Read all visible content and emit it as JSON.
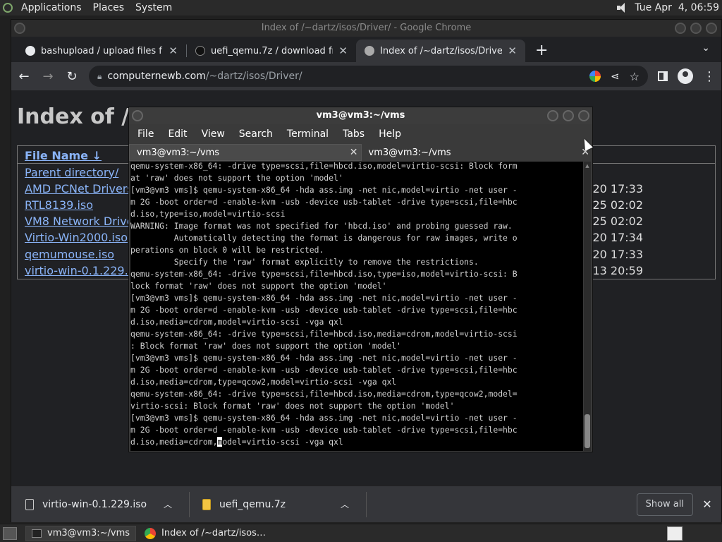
{
  "top_panel": {
    "menus": [
      "Applications",
      "Places",
      "System"
    ],
    "clock": "Tue Apr  4, 06:59"
  },
  "chrome": {
    "window_title": "Index of /~dartz/isos/Driver/ - Google Chrome",
    "tabs": [
      {
        "title": "bashupload / upload files from",
        "active": false
      },
      {
        "title": "uefi_qemu.7z / download from",
        "active": false
      },
      {
        "title": "Index of /~dartz/isos/Driver/",
        "active": true
      }
    ],
    "url_host": "computernewb.com",
    "url_path": "/~dartz/isos/Driver/"
  },
  "page": {
    "heading": "Index of /~",
    "column_header": "File Name  ↓",
    "files": [
      {
        "name": "Parent directory/",
        "date": ""
      },
      {
        "name": "AMD PCNet Drivers.",
        "date": "r-20 17:33"
      },
      {
        "name": "RTL8139.iso",
        "date": "-25 02:02"
      },
      {
        "name": "VM8 Network Drivers",
        "date": "-25 02:02"
      },
      {
        "name": "Virtio-Win2000.iso",
        "date": "-20 17:34"
      },
      {
        "name": "qemumouse.iso",
        "date": "-20 17:33"
      },
      {
        "name": "virtio-win-0.1.229.iso",
        "date": "-13 20:59"
      }
    ]
  },
  "downloads": {
    "items": [
      {
        "name": "virtio-win-0.1.229.iso"
      },
      {
        "name": "uefi_qemu.7z"
      }
    ],
    "show_all": "Show all"
  },
  "terminal": {
    "title": "vm3@vm3:~/vms",
    "menu": [
      "File",
      "Edit",
      "View",
      "Search",
      "Terminal",
      "Tabs",
      "Help"
    ],
    "tabs": [
      "vm3@vm3:~/vms",
      "vm3@vm3:~/vms"
    ],
    "lines": [
      {
        "text": "qemu-system-x86_64: -drive type=scsi,file=hbcd.iso,model=virtio-scsi: Block form"
      },
      {
        "text": "at 'raw' does not support the option 'model'"
      },
      {
        "text": "[vm3@vm3 vms]$ qemu-system-x86_64 -hda ass.img -net nic,model=virtio -net user -"
      },
      {
        "text": "m 2G -boot order=d -enable-kvm -usb -device usb-tablet -drive type=scsi,file=hbc"
      },
      {
        "text": "d.iso,type=iso,model=virtio-scsi"
      },
      {
        "text": "WARNING: Image format was not specified for 'hbcd.iso' and probing guessed raw."
      },
      {
        "text": "         Automatically detecting the format is dangerous for raw images, write o"
      },
      {
        "text": "perations on block 0 will be restricted."
      },
      {
        "text": "         Specify the 'raw' format explicitly to remove the restrictions."
      },
      {
        "text": "qemu-system-x86_64: -drive type=scsi,file=hbcd.iso,type=iso,model=virtio-scsi: B"
      },
      {
        "text": "lock format 'raw' does not support the option 'model'"
      },
      {
        "text": "[vm3@vm3 vms]$ qemu-system-x86_64 -hda ass.img -net nic,model=virtio -net user -"
      },
      {
        "text": "m 2G -boot order=d -enable-kvm -usb -device usb-tablet -drive type=scsi,file=hbc"
      },
      {
        "text": "d.iso,media=cdrom,model=virtio-scsi -vga qxl"
      },
      {
        "text": "qemu-system-x86_64: -drive type=scsi,file=hbcd.iso,media=cdrom,model=virtio-scsi"
      },
      {
        "text": ": Block format 'raw' does not support the option 'model'"
      },
      {
        "text": "[vm3@vm3 vms]$ qemu-system-x86_64 -hda ass.img -net nic,model=virtio -net user -"
      },
      {
        "text": "m 2G -boot order=d -enable-kvm -usb -device usb-tablet -drive type=scsi,file=hbc"
      },
      {
        "text": "d.iso,media=cdrom,type=qcow2,model=virtio-scsi -vga qxl"
      },
      {
        "text": "qemu-system-x86_64: -drive type=scsi,file=hbcd.iso,media=cdrom,type=qcow2,model="
      },
      {
        "text": "virtio-scsi: Block format 'raw' does not support the option 'model'"
      },
      {
        "text": "[vm3@vm3 vms]$ qemu-system-x86_64 -hda ass.img -net nic,model=virtio -net user -"
      },
      {
        "text": "m 2G -boot order=d -enable-kvm -usb -device usb-tablet -drive type=scsi,file=hbc"
      },
      {
        "text": "d.iso,media=cdrom,",
        "cursor": "m",
        "after": "odel=virtio-scsi -vga qxl"
      }
    ]
  },
  "taskbar": {
    "items": [
      {
        "label": "vm3@vm3:~/vms",
        "active": true
      },
      {
        "label": "Index of /~dartz/isos…",
        "active": false
      }
    ]
  }
}
